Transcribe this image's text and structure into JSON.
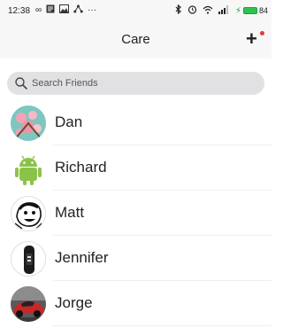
{
  "status_bar": {
    "time": "12:38",
    "left_icons": [
      "infinity-icon",
      "notes-icon",
      "gallery-icon",
      "share-icon",
      "more-dots-icon"
    ],
    "right_icons": [
      "bluetooth-icon",
      "alarm-icon",
      "wifi-icon",
      "signal-icon",
      "battery-icon"
    ],
    "battery_level": "84"
  },
  "nav": {
    "title": "Care",
    "add_icon": "plus-icon"
  },
  "search": {
    "placeholder": "Search Friends"
  },
  "friends": [
    {
      "name": "Dan",
      "avatar": "flowers-photo"
    },
    {
      "name": "Richard",
      "avatar": "android-robot"
    },
    {
      "name": "Matt",
      "avatar": "cartoon-face"
    },
    {
      "name": "Jennifer",
      "avatar": "fitness-band"
    },
    {
      "name": "Jorge",
      "avatar": "red-car-photo"
    }
  ],
  "colors": {
    "accent_red": "#e53935",
    "battery_green": "#2ec24e",
    "search_bg": "#e1e1e3"
  }
}
